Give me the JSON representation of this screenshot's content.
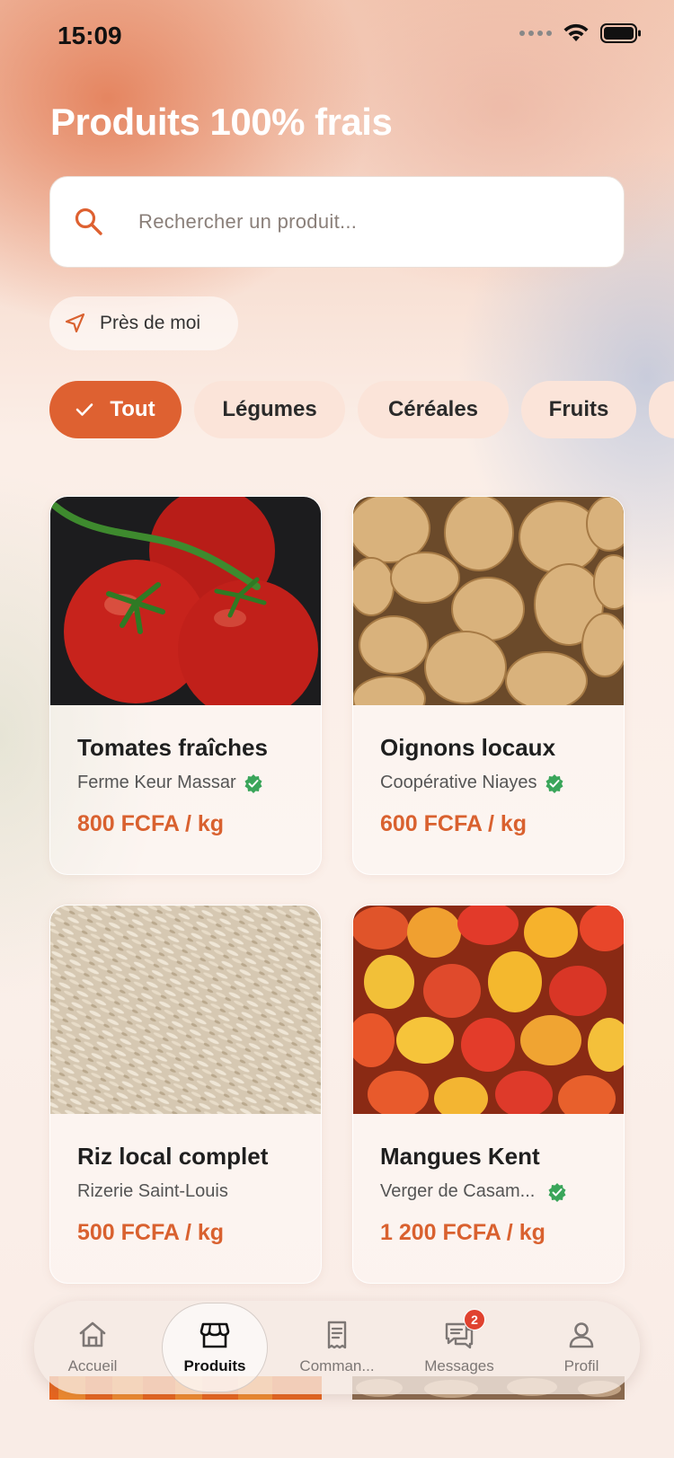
{
  "status_bar": {
    "time": "15:09"
  },
  "header": {
    "title": "Produits 100% frais"
  },
  "search": {
    "placeholder": "Rechercher un produit..."
  },
  "location_chip": {
    "label": "Près de moi"
  },
  "categories": [
    {
      "label": "Tout",
      "selected": true
    },
    {
      "label": "Légumes",
      "selected": false
    },
    {
      "label": "Céréales",
      "selected": false
    },
    {
      "label": "Fruits",
      "selected": false
    }
  ],
  "products": [
    {
      "name": "Tomates fraîches",
      "seller": "Ferme Keur Massar",
      "verified": true,
      "price": "800 FCFA / kg",
      "image": "tomatoes"
    },
    {
      "name": "Oignons locaux",
      "seller": "Coopérative Niayes",
      "verified": true,
      "price": "600 FCFA / kg",
      "image": "onions"
    },
    {
      "name": "Riz local complet",
      "seller": "Rizerie Saint-Louis",
      "verified": false,
      "price": "500 FCFA / kg",
      "image": "rice"
    },
    {
      "name": "Mangues Kent",
      "seller": "Verger de Casam...",
      "verified": true,
      "price": "1 200 FCFA / kg",
      "image": "mangoes"
    }
  ],
  "tab_bar": {
    "tabs": [
      {
        "label": "Accueil",
        "icon": "home-icon"
      },
      {
        "label": "Produits",
        "icon": "store-icon",
        "active": true
      },
      {
        "label": "Comman...",
        "icon": "receipt-icon"
      },
      {
        "label": "Messages",
        "icon": "chat-icon",
        "badge": "2"
      },
      {
        "label": "Profil",
        "icon": "user-icon"
      }
    ]
  },
  "colors": {
    "accent": "#de6131",
    "price": "#d9612f",
    "verified": "#3aa55a",
    "badge": "#e0422f"
  }
}
